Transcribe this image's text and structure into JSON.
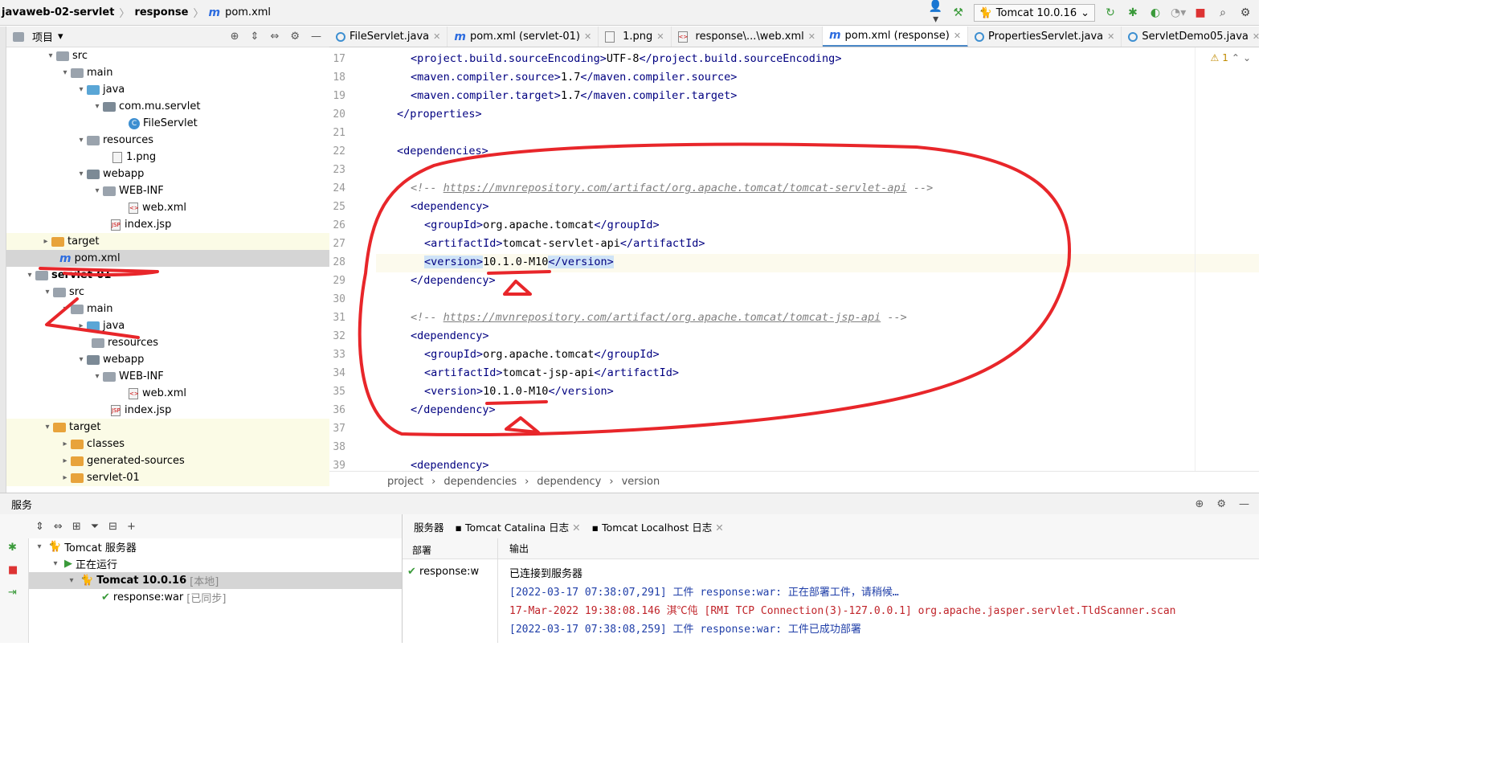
{
  "breadcrumb": {
    "project": "javaweb-02-servlet",
    "module": "response",
    "file": "pom.xml"
  },
  "toolbar": {
    "run_config": "Tomcat 10.0.16"
  },
  "project_panel": {
    "title": "项目"
  },
  "tree": [
    {
      "label": "src",
      "icon": "folder-icon",
      "kind": "g"
    },
    {
      "label": "main",
      "icon": "folder-icon",
      "kind": "g"
    },
    {
      "label": "java",
      "icon": "source-folder-icon",
      "kind": "b"
    },
    {
      "label": "com.mu.servlet",
      "icon": "package-icon",
      "kind": "g"
    },
    {
      "label": "FileServlet",
      "icon": "class-icon",
      "kind": "c"
    },
    {
      "label": "resources",
      "icon": "resources-folder-icon",
      "kind": "g"
    },
    {
      "label": "1.png",
      "icon": "image-file-icon",
      "kind": "f"
    },
    {
      "label": "webapp",
      "icon": "web-folder-icon",
      "kind": "g"
    },
    {
      "label": "WEB-INF",
      "icon": "folder-icon",
      "kind": "g"
    },
    {
      "label": "web.xml",
      "icon": "xml-file-icon",
      "kind": "f"
    },
    {
      "label": "index.jsp",
      "icon": "jsp-file-icon",
      "kind": "f"
    },
    {
      "label": "target",
      "icon": "folder-icon",
      "kind": "o"
    },
    {
      "label": "pom.xml",
      "icon": "maven-icon",
      "kind": "m"
    },
    {
      "label": "servlet-01",
      "icon": "module-icon",
      "kind": "g"
    },
    {
      "label": "src",
      "icon": "folder-icon",
      "kind": "g"
    },
    {
      "label": "main",
      "icon": "folder-icon",
      "kind": "g"
    },
    {
      "label": "java",
      "icon": "source-folder-icon",
      "kind": "b"
    },
    {
      "label": "resources",
      "icon": "resources-folder-icon",
      "kind": "g"
    },
    {
      "label": "webapp",
      "icon": "web-folder-icon",
      "kind": "g"
    },
    {
      "label": "WEB-INF",
      "icon": "folder-icon",
      "kind": "g"
    },
    {
      "label": "web.xml",
      "icon": "xml-file-icon",
      "kind": "f"
    },
    {
      "label": "index.jsp",
      "icon": "jsp-file-icon",
      "kind": "f"
    },
    {
      "label": "target",
      "icon": "folder-icon",
      "kind": "o"
    },
    {
      "label": "classes",
      "icon": "folder-icon",
      "kind": "o"
    },
    {
      "label": "generated-sources",
      "icon": "folder-icon",
      "kind": "o"
    },
    {
      "label": "servlet-01",
      "icon": "folder-icon",
      "kind": "o"
    }
  ],
  "tabs": [
    {
      "label": "FileServlet.java"
    },
    {
      "label": "pom.xml (servlet-01)"
    },
    {
      "label": "1.png"
    },
    {
      "label": "response\\...\\web.xml"
    },
    {
      "label": "pom.xml (response)"
    },
    {
      "label": "PropertiesServlet.java"
    },
    {
      "label": "ServletDemo05.java"
    }
  ],
  "editor": {
    "warnings": "1",
    "lines": [
      "17",
      "18",
      "19",
      "20",
      "21",
      "22",
      "23",
      "24",
      "25",
      "26",
      "27",
      "28",
      "29",
      "30",
      "31",
      "32",
      "33",
      "34",
      "35",
      "36",
      "37",
      "38",
      "39"
    ],
    "code": {
      "l17": {
        "open": "<project.build.sourceEncoding>",
        "val": "UTF-8",
        "close": "</project.build.sourceEncoding>"
      },
      "l18": {
        "open": "<maven.compiler.source>",
        "val": "1.7",
        "close": "</maven.compiler.source>"
      },
      "l19": {
        "open": "<maven.compiler.target>",
        "val": "1.7",
        "close": "</maven.compiler.target>"
      },
      "l20": "</properties>",
      "l22": "<dependencies>",
      "l24": {
        "pre": "<!-- ",
        "url": "https://mvnrepository.com/artifact/org.apache.tomcat/tomcat-servlet-api",
        "post": " -->"
      },
      "l25": "<dependency>",
      "l26": {
        "open": "<groupId>",
        "val": "org.apache.tomcat",
        "close": "</groupId>"
      },
      "l27": {
        "open": "<artifactId>",
        "val": "tomcat-servlet-api",
        "close": "</artifactId>"
      },
      "l28": {
        "open": "<version>",
        "val": "10.1.0-M10",
        "close": "</version>"
      },
      "l29": "</dependency>",
      "l31": {
        "pre": "<!-- ",
        "url": "https://mvnrepository.com/artifact/org.apache.tomcat/tomcat-jsp-api",
        "post": " -->"
      },
      "l32": "<dependency>",
      "l33": {
        "open": "<groupId>",
        "val": "org.apache.tomcat",
        "close": "</groupId>"
      },
      "l34": {
        "open": "<artifactId>",
        "val": "tomcat-jsp-api",
        "close": "</artifactId>"
      },
      "l35": {
        "open": "<version>",
        "val": "10.1.0-M10",
        "close": "</version>"
      },
      "l36": "</dependency>",
      "l39": "<dependency>"
    },
    "breadcrumb": [
      "project",
      "dependencies",
      "dependency",
      "version"
    ]
  },
  "services": {
    "title": "服务",
    "tree": {
      "root": "Tomcat 服务器",
      "running": "正在运行",
      "server": "Tomcat 10.0.16",
      "server_tag": "[本地]",
      "artifact": "response:war",
      "artifact_tag": "[已同步]"
    },
    "out_tabs": [
      "服务器",
      "Tomcat Catalina 日志",
      "Tomcat Localhost 日志"
    ],
    "deploy_header": "部署",
    "deploy_item": "response:w",
    "output_header": "输出",
    "output": [
      "已连接到服务器",
      "[2022-03-17 07:38:07,291] 工件 response:war: 正在部署工件，请稍候…",
      "17-Mar-2022 19:38:08.146 淇℃伅 [RMI TCP Connection(3)-127.0.0.1] org.apache.jasper.servlet.TldScanner.scan",
      "[2022-03-17 07:38:08,259] 工件 response:war: 工件已成功部署"
    ]
  },
  "colors": {
    "annotation": "#e8262a",
    "tag": "#000080",
    "accent": "#4a88c7"
  }
}
